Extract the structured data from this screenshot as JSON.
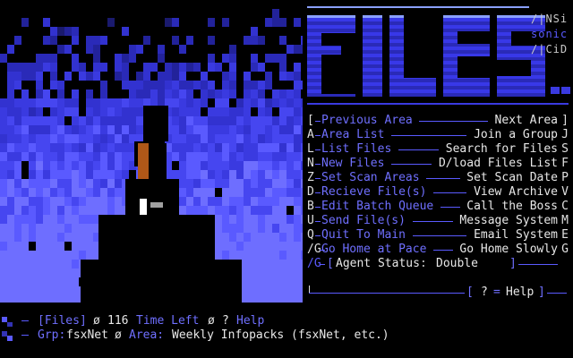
{
  "tag": {
    "line1": "/|NSi",
    "line2": "sonic",
    "line3": "/|CiD"
  },
  "menu": [
    {
      "key": "[",
      "left": "Previous Area",
      "right": "Next Area",
      "rkey": "]"
    },
    {
      "key": "A",
      "left": "Area List",
      "right": "Join a Group",
      "rkey": "J"
    },
    {
      "key": "L",
      "left": "List Files",
      "right": "Search for Files",
      "rkey": "S"
    },
    {
      "key": "N",
      "left": "New Files",
      "right": "D/load Files List",
      "rkey": "F"
    },
    {
      "key": "Z",
      "left": "Set Scan Areas",
      "right": "Set Scan Date",
      "rkey": "P"
    },
    {
      "key": "D",
      "left": "Recieve File(s)",
      "right": "View Archive",
      "rkey": "V"
    },
    {
      "key": "B",
      "left": "Edit Batch Queue",
      "right": "Call the Boss",
      "rkey": "C"
    },
    {
      "key": "U",
      "left": "Send File(s)",
      "right": "Message System",
      "rkey": "M"
    },
    {
      "key": "Q",
      "left": "Quit To Main",
      "right": "Email System",
      "rkey": "E"
    },
    {
      "key": "/G",
      "left": "Go Home at Pace",
      "right": "Go Home Slowly",
      "rkey": "G"
    }
  ],
  "status": {
    "label": "Agent Status",
    "value": "Double"
  },
  "help_hint": {
    "key": "?",
    "label": "Help"
  },
  "bottom": {
    "section": "[Files]",
    "count": "116",
    "time_label": "Time Left",
    "time_value": "?",
    "help": "Help",
    "grp_label": "Grp:",
    "grp_value": "fsxNet",
    "area_label": "Area:",
    "area_value": "Weekly Infopacks (fsxNet, etc.)"
  },
  "colors": {
    "accent": "#5a5aff",
    "highlight": "#6f6fff",
    "text": "#c8c8c8",
    "white": "#e8e8e8",
    "background": "#000000"
  },
  "logo_text": "FILES"
}
